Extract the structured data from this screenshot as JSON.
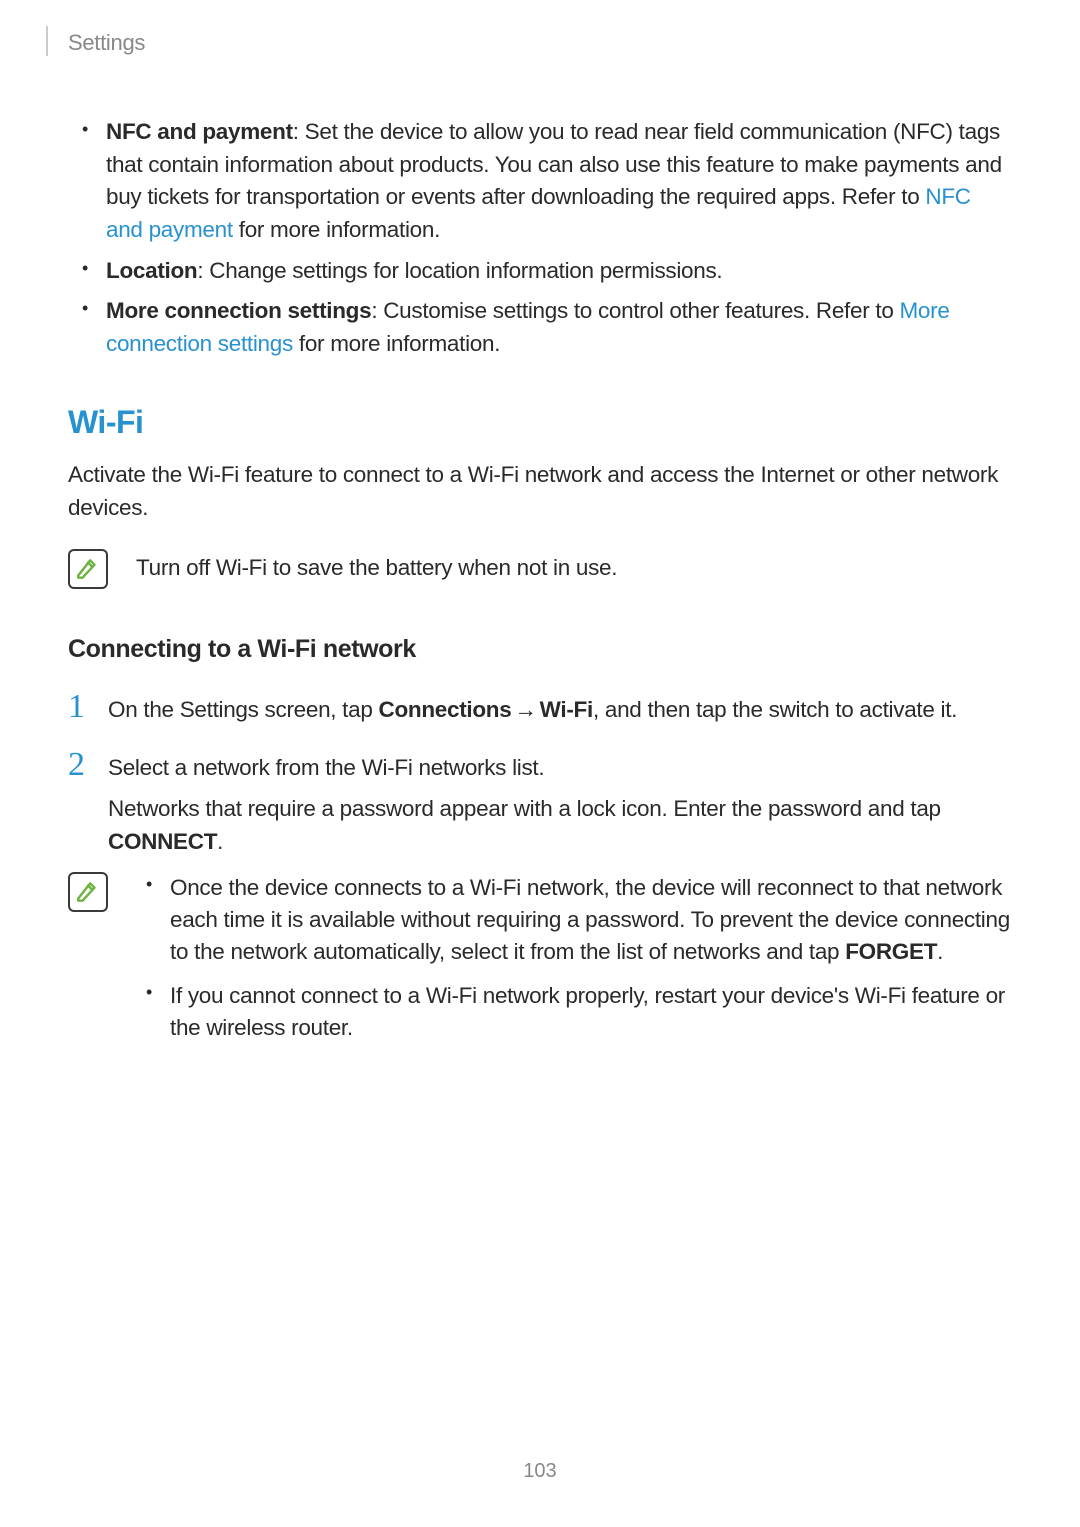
{
  "header": {
    "breadcrumb": "Settings"
  },
  "bullets": {
    "nfc": {
      "label": "NFC and payment",
      "text1": ": Set the device to allow you to read near field communication (NFC) tags that contain information about products. You can also use this feature to make payments and buy tickets for transportation or events after downloading the required apps. Refer to ",
      "link": "NFC and payment",
      "text2": " for more information."
    },
    "location": {
      "label": "Location",
      "text": ": Change settings for location information permissions."
    },
    "more": {
      "label": "More connection settings",
      "text1": ": Customise settings to control other features. Refer to ",
      "link": "More connection settings",
      "text2": " for more information."
    }
  },
  "wifi": {
    "heading": "Wi-Fi",
    "intro": "Activate the Wi-Fi feature to connect to a Wi-Fi network and access the Internet or other network devices.",
    "note1": "Turn off Wi-Fi to save the battery when not in use."
  },
  "connecting": {
    "heading": "Connecting to a Wi-Fi network",
    "step1": {
      "num": "1",
      "pre": "On the Settings screen, tap ",
      "b1": "Connections",
      "arrow": "→",
      "b2": "Wi-Fi",
      "post": ", and then tap the switch to activate it."
    },
    "step2": {
      "num": "2",
      "line1": "Select a network from the Wi-Fi networks list.",
      "line2a": "Networks that require a password appear with a lock icon. Enter the password and tap ",
      "connect": "CONNECT",
      "line2b": "."
    },
    "note2": {
      "item1a": "Once the device connects to a Wi-Fi network, the device will reconnect to that network each time it is available without requiring a password. To prevent the device connecting to the network automatically, select it from the list of networks and tap ",
      "forget": "FORGET",
      "item1b": ".",
      "item2": "If you cannot connect to a Wi-Fi network properly, restart your device's Wi-Fi feature or the wireless router."
    }
  },
  "pageNumber": "103"
}
